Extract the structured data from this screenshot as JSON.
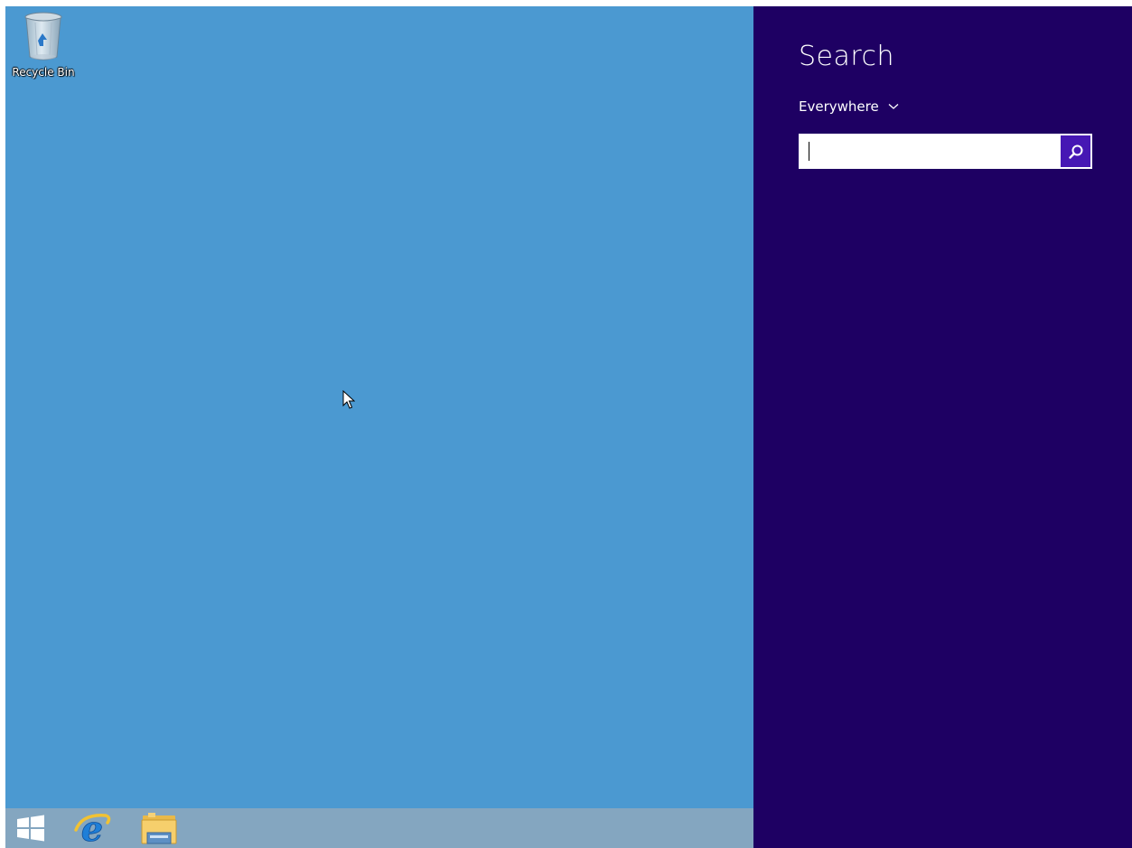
{
  "desktop": {
    "background_color": "#4b99d1",
    "icons": [
      {
        "label": "Recycle Bin",
        "icon": "recycle-bin-icon"
      }
    ]
  },
  "taskbar": {
    "background_color": "#84a6c0",
    "items": [
      {
        "name": "start",
        "icon": "windows-logo-icon"
      },
      {
        "name": "internet-explorer",
        "icon": "internet-explorer-icon"
      },
      {
        "name": "file-explorer",
        "icon": "folder-icon"
      }
    ]
  },
  "search_charm": {
    "background_color": "#1e0063",
    "title": "Search",
    "scope": {
      "selected": "Everywhere",
      "icon": "chevron-down-icon"
    },
    "input": {
      "value": "",
      "placeholder": ""
    },
    "button": {
      "icon": "search-icon",
      "color": "#4617b4"
    }
  }
}
